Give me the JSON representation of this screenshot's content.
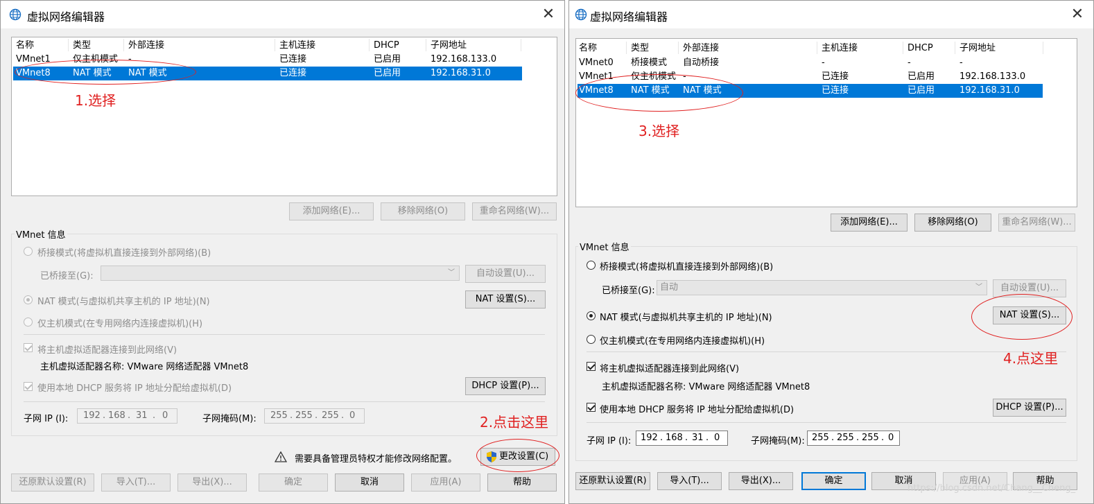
{
  "left": {
    "title": "虚拟网络编辑器",
    "close": "✕",
    "columns": [
      "名称",
      "类型",
      "外部连接",
      "主机连接",
      "DHCP",
      "子网地址"
    ],
    "rows": [
      [
        "VMnet1",
        "仅主机模式",
        "-",
        "已连接",
        "已启用",
        "192.168.133.0"
      ],
      [
        "VMnet8",
        "NAT 模式",
        "NAT 模式",
        "已连接",
        "已启用",
        "192.168.31.0"
      ]
    ],
    "selected_row": "VMnet8",
    "buttons": {
      "add": "添加网络(E)...",
      "remove": "移除网络(O)",
      "rename": "重命名网络(W)..."
    },
    "vmnet_info": "VMnet 信息",
    "bridge_mode": "桥接模式(将虚拟机直接连接到外部网络)(B)",
    "bridged_to": "已桥接至(G):",
    "bridged_value": "",
    "auto_settings": "自动设置(U)...",
    "nat_mode": "NAT 模式(与虚拟机共享主机的 IP 地址)(N)",
    "nat_settings": "NAT 设置(S)...",
    "host_only": "仅主机模式(在专用网络内连接虚拟机)(H)",
    "connect_adapter": "将主机虚拟适配器连接到此网络(V)",
    "adapter_name": "主机虚拟适配器名称: VMware 网络适配器 VMnet8",
    "use_dhcp": "使用本地 DHCP 服务将 IP 地址分配给虚拟机(D)",
    "dhcp_settings": "DHCP 设置(P)...",
    "subnet_ip_label": "子网 IP (I):",
    "subnet_ip": [
      "192",
      "168",
      "31",
      "0"
    ],
    "subnet_mask_label": "子网掩码(M):",
    "subnet_mask": [
      "255",
      "255",
      "255",
      "0"
    ],
    "admin_warning": "需要具备管理员特权才能修改网络配置。",
    "change_settings": "更改设置(C)",
    "bottom": {
      "restore": "还原默认设置(R)",
      "import": "导入(T)...",
      "export": "导出(X)...",
      "ok": "确定",
      "cancel": "取消",
      "apply": "应用(A)",
      "help": "帮助"
    },
    "annotations": {
      "a1": "1.选择",
      "a2": "2.点击这里"
    }
  },
  "right": {
    "title": "虚拟网络编辑器",
    "close": "✕",
    "columns": [
      "名称",
      "类型",
      "外部连接",
      "主机连接",
      "DHCP",
      "子网地址"
    ],
    "rows": [
      [
        "VMnet0",
        "桥接模式",
        "自动桥接",
        "-",
        "-",
        "-"
      ],
      [
        "VMnet1",
        "仅主机模式",
        "-",
        "已连接",
        "已启用",
        "192.168.133.0"
      ],
      [
        "VMnet8",
        "NAT 模式",
        "NAT 模式",
        "已连接",
        "已启用",
        "192.168.31.0"
      ]
    ],
    "selected_row": "VMnet8",
    "buttons": {
      "add": "添加网络(E)...",
      "remove": "移除网络(O)",
      "rename": "重命名网络(W)..."
    },
    "vmnet_info": "VMnet 信息",
    "bridge_mode": "桥接模式(将虚拟机直接连接到外部网络)(B)",
    "bridged_to": "已桥接至(G):",
    "bridged_value": "自动",
    "auto_settings": "自动设置(U)...",
    "nat_mode": "NAT 模式(与虚拟机共享主机的 IP 地址)(N)",
    "nat_settings": "NAT 设置(S)...",
    "host_only": "仅主机模式(在专用网络内连接虚拟机)(H)",
    "connect_adapter": "将主机虚拟适配器连接到此网络(V)",
    "adapter_name": "主机虚拟适配器名称: VMware 网络适配器 VMnet8",
    "use_dhcp": "使用本地 DHCP 服务将 IP 地址分配给虚拟机(D)",
    "dhcp_settings": "DHCP 设置(P)...",
    "subnet_ip_label": "子网 IP (I):",
    "subnet_ip": [
      "192",
      "168",
      "31",
      "0"
    ],
    "subnet_mask_label": "子网掩码(M):",
    "subnet_mask": [
      "255",
      "255",
      "255",
      "0"
    ],
    "bottom": {
      "restore": "还原默认设置(R)",
      "import": "导入(T)...",
      "export": "导出(X)...",
      "ok": "确定",
      "cancel": "取消",
      "apply": "应用(A)",
      "help": "帮助"
    },
    "annotations": {
      "a3": "3.选择",
      "a4": "4.点这里"
    },
    "watermark": "https://blog.csdn.net/Chang__Cheng_"
  },
  "colors": {
    "selection": "#0078d7",
    "annotation": "#e02020",
    "dialog_bg": "#f0f0f0"
  }
}
